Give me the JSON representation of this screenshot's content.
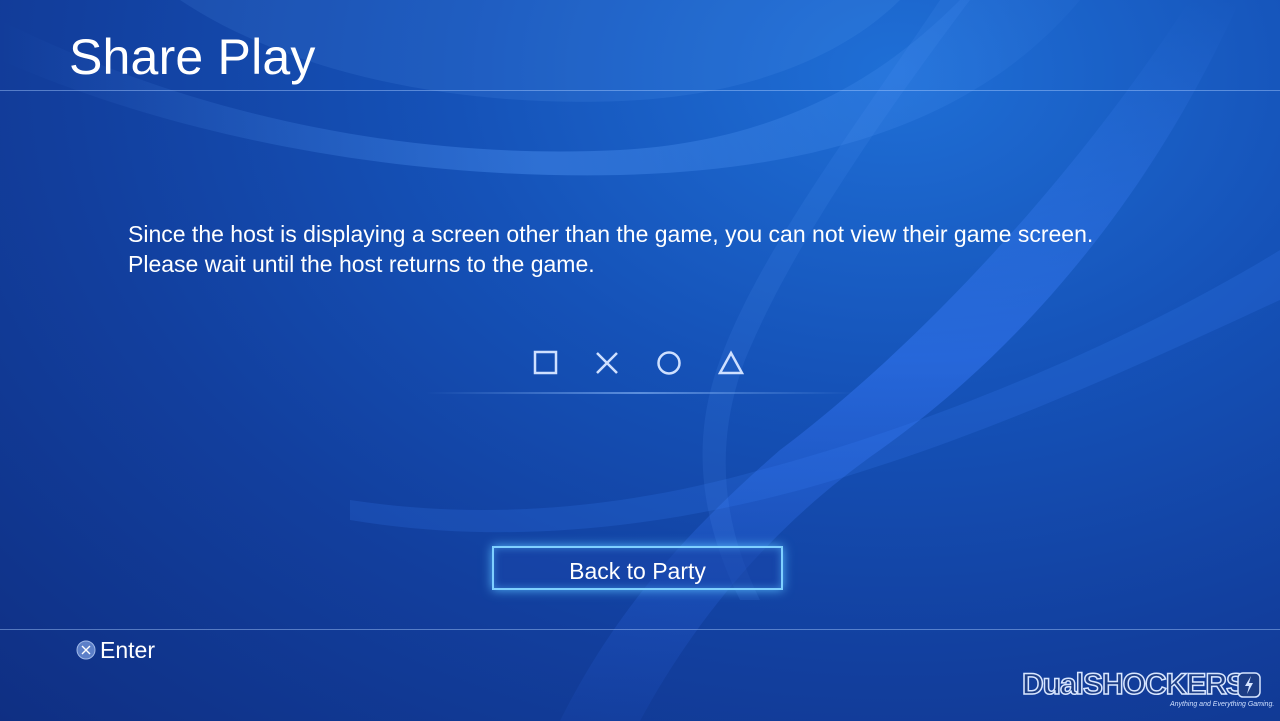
{
  "header": {
    "title": "Share Play"
  },
  "message": {
    "line1": "Since the host is displaying a screen other than the game, you can not view their game screen.",
    "line2": "Please wait until the host returns to the game."
  },
  "symbols": [
    "square-icon",
    "cross-icon",
    "circle-icon",
    "triangle-icon"
  ],
  "button": {
    "label": "Back to Party"
  },
  "footer": {
    "enter_label": "Enter"
  },
  "watermark": {
    "text": "DualSHOCKERS",
    "tagline": "Anything and Everything Gaming."
  },
  "colors": {
    "background": "#1552b8",
    "button_border": "#7fd0ff",
    "text": "#ffffff"
  }
}
